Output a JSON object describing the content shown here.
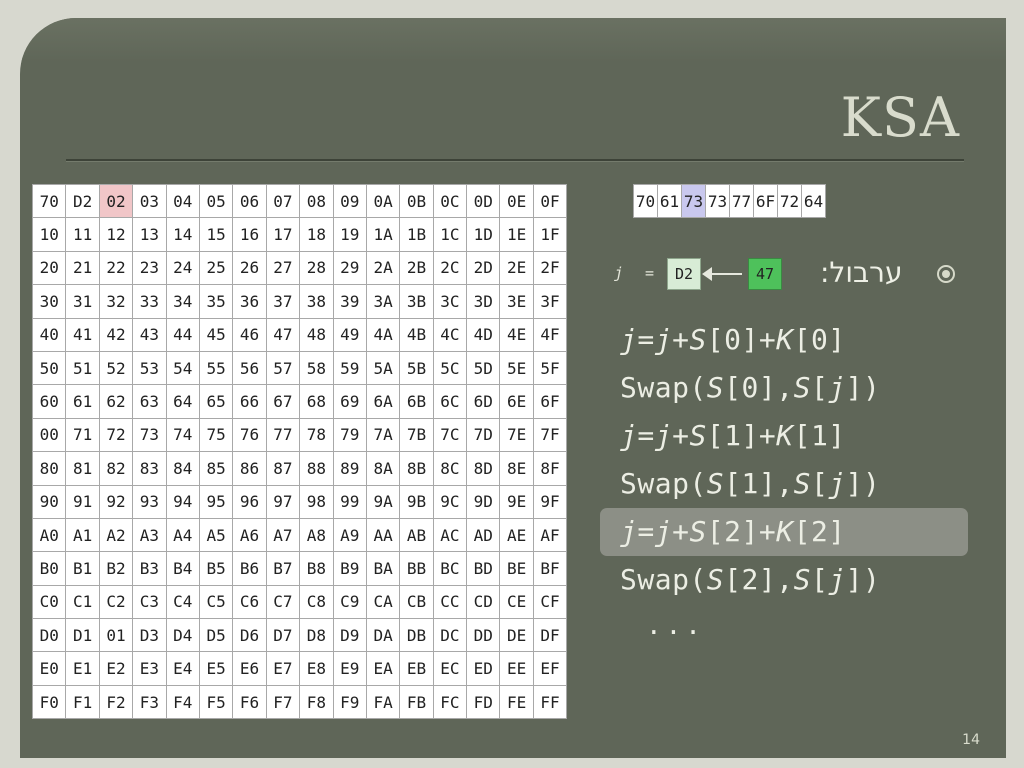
{
  "slide": {
    "title": "KSA",
    "page_number": "14",
    "bullet_text": "ערבול:",
    "j_label": "j",
    "j_equals": "=",
    "j_value": "D2",
    "new_value": "47",
    "ellipsis": "..."
  },
  "sbox": {
    "highlight_cell": 2,
    "cells": [
      "70",
      "D2",
      "02",
      "03",
      "04",
      "05",
      "06",
      "07",
      "08",
      "09",
      "0A",
      "0B",
      "0C",
      "0D",
      "0E",
      "0F",
      "10",
      "11",
      "12",
      "13",
      "14",
      "15",
      "16",
      "17",
      "18",
      "19",
      "1A",
      "1B",
      "1C",
      "1D",
      "1E",
      "1F",
      "20",
      "21",
      "22",
      "23",
      "24",
      "25",
      "26",
      "27",
      "28",
      "29",
      "2A",
      "2B",
      "2C",
      "2D",
      "2E",
      "2F",
      "30",
      "31",
      "32",
      "33",
      "34",
      "35",
      "36",
      "37",
      "38",
      "39",
      "3A",
      "3B",
      "3C",
      "3D",
      "3E",
      "3F",
      "40",
      "41",
      "42",
      "43",
      "44",
      "45",
      "46",
      "47",
      "48",
      "49",
      "4A",
      "4B",
      "4C",
      "4D",
      "4E",
      "4F",
      "50",
      "51",
      "52",
      "53",
      "54",
      "55",
      "56",
      "57",
      "58",
      "59",
      "5A",
      "5B",
      "5C",
      "5D",
      "5E",
      "5F",
      "60",
      "61",
      "62",
      "63",
      "64",
      "65",
      "66",
      "67",
      "68",
      "69",
      "6A",
      "6B",
      "6C",
      "6D",
      "6E",
      "6F",
      "00",
      "71",
      "72",
      "73",
      "74",
      "75",
      "76",
      "77",
      "78",
      "79",
      "7A",
      "7B",
      "7C",
      "7D",
      "7E",
      "7F",
      "80",
      "81",
      "82",
      "83",
      "84",
      "85",
      "86",
      "87",
      "88",
      "89",
      "8A",
      "8B",
      "8C",
      "8D",
      "8E",
      "8F",
      "90",
      "91",
      "92",
      "93",
      "94",
      "95",
      "96",
      "97",
      "98",
      "99",
      "9A",
      "9B",
      "9C",
      "9D",
      "9E",
      "9F",
      "A0",
      "A1",
      "A2",
      "A3",
      "A4",
      "A5",
      "A6",
      "A7",
      "A8",
      "A9",
      "AA",
      "AB",
      "AC",
      "AD",
      "AE",
      "AF",
      "B0",
      "B1",
      "B2",
      "B3",
      "B4",
      "B5",
      "B6",
      "B7",
      "B8",
      "B9",
      "BA",
      "BB",
      "BC",
      "BD",
      "BE",
      "BF",
      "C0",
      "C1",
      "C2",
      "C3",
      "C4",
      "C5",
      "C6",
      "C7",
      "C8",
      "C9",
      "CA",
      "CB",
      "CC",
      "CD",
      "CE",
      "CF",
      "D0",
      "D1",
      "01",
      "D3",
      "D4",
      "D5",
      "D6",
      "D7",
      "D8",
      "D9",
      "DA",
      "DB",
      "DC",
      "DD",
      "DE",
      "DF",
      "E0",
      "E1",
      "E2",
      "E3",
      "E4",
      "E5",
      "E6",
      "E7",
      "E8",
      "E9",
      "EA",
      "EB",
      "EC",
      "ED",
      "EE",
      "EF",
      "F0",
      "F1",
      "F2",
      "F3",
      "F4",
      "F5",
      "F6",
      "F7",
      "F8",
      "F9",
      "FA",
      "FB",
      "FC",
      "FD",
      "FE",
      "FF"
    ]
  },
  "key": {
    "highlight_cell": 2,
    "cells": [
      "70",
      "61",
      "73",
      "73",
      "77",
      "6F",
      "72",
      "64"
    ]
  },
  "code": {
    "active_line": 4,
    "lines": [
      [
        {
          "t": "j",
          "i": true
        },
        {
          "t": "="
        },
        {
          "t": "j",
          "i": true
        },
        {
          "t": "+"
        },
        {
          "t": "S",
          "i": true
        },
        {
          "t": "[0]+"
        },
        {
          "t": "K",
          "i": true
        },
        {
          "t": "[0]"
        }
      ],
      [
        {
          "t": "Swap("
        },
        {
          "t": "S",
          "i": true
        },
        {
          "t": "[0],"
        },
        {
          "t": "S",
          "i": true
        },
        {
          "t": "["
        },
        {
          "t": "j",
          "i": true
        },
        {
          "t": "])"
        }
      ],
      [
        {
          "t": "j",
          "i": true
        },
        {
          "t": "="
        },
        {
          "t": "j",
          "i": true
        },
        {
          "t": "+"
        },
        {
          "t": "S",
          "i": true
        },
        {
          "t": "[1]+"
        },
        {
          "t": "K",
          "i": true
        },
        {
          "t": "[1]"
        }
      ],
      [
        {
          "t": "Swap("
        },
        {
          "t": "S",
          "i": true
        },
        {
          "t": "[1],"
        },
        {
          "t": "S",
          "i": true
        },
        {
          "t": "["
        },
        {
          "t": "j",
          "i": true
        },
        {
          "t": "])"
        }
      ],
      [
        {
          "t": "j",
          "i": true
        },
        {
          "t": "="
        },
        {
          "t": "j",
          "i": true
        },
        {
          "t": "+"
        },
        {
          "t": "S",
          "i": true
        },
        {
          "t": "[2]+"
        },
        {
          "t": "K",
          "i": true
        },
        {
          "t": "[2]"
        }
      ],
      [
        {
          "t": "Swap("
        },
        {
          "t": "S",
          "i": true
        },
        {
          "t": "[2],"
        },
        {
          "t": "S",
          "i": true
        },
        {
          "t": "["
        },
        {
          "t": "j",
          "i": true
        },
        {
          "t": "])"
        }
      ]
    ]
  },
  "colors": {
    "background": "#5f6658",
    "sbox_highlight": "#f1c6c8",
    "key_highlight": "#c9c8ee",
    "value_box": "#4ec15b",
    "j_box": "#d8ecd6"
  }
}
